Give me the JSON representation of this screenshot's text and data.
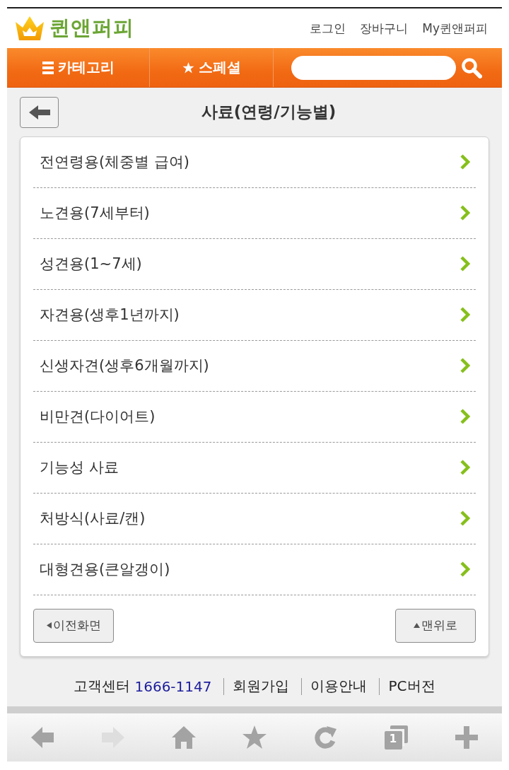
{
  "header": {
    "logo_text": "퀸앤퍼피",
    "links": [
      "로그인",
      "장바구니",
      "My퀸앤퍼피"
    ]
  },
  "nav": {
    "items": [
      {
        "kind": "menu",
        "label": "카테고리"
      },
      {
        "kind": "star",
        "label": "스페셜"
      }
    ]
  },
  "page": {
    "title": "사료(연령/기능별)"
  },
  "categories": [
    "전연령용(체중별 급여)",
    "노견용(7세부터)",
    "성견용(1~7세)",
    "자견용(생후1년까지)",
    "신생자견(생후6개월까지)",
    "비만견(다이어트)",
    "기능성 사료",
    "처방식(사료/캔)",
    "대형견용(큰알갱이)"
  ],
  "buttons": [
    {
      "kind": "back",
      "label": "이전화면"
    },
    {
      "kind": "top",
      "label": "맨위로"
    }
  ],
  "footer": {
    "center_label": "고객센터",
    "phone": "1666-1147",
    "links": [
      "회원가입",
      "이용안내",
      "PC버전"
    ]
  },
  "browser_toolbar": {
    "items": [
      {
        "kind": "back",
        "disabled": false
      },
      {
        "kind": "forward",
        "disabled": true
      },
      {
        "kind": "home",
        "disabled": false
      },
      {
        "kind": "bookmark",
        "disabled": false
      },
      {
        "kind": "reload",
        "disabled": false
      },
      {
        "kind": "tabs",
        "disabled": false,
        "count": "1"
      },
      {
        "kind": "add",
        "disabled": false
      }
    ]
  }
}
